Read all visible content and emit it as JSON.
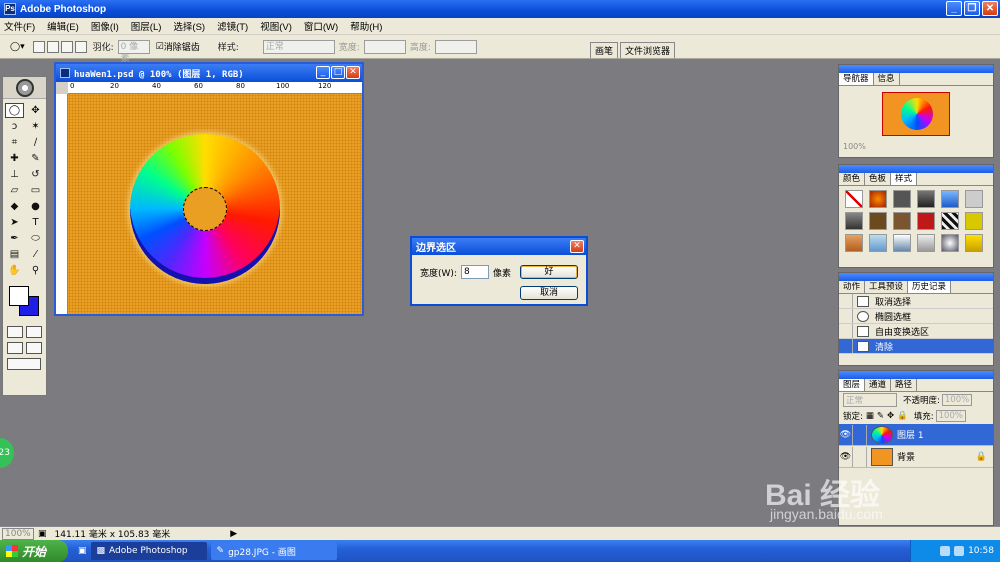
{
  "app": {
    "title": "Adobe Photoshop"
  },
  "menu": [
    "文件(F)",
    "编辑(E)",
    "图像(I)",
    "图层(L)",
    "选择(S)",
    "滤镜(T)",
    "视图(V)",
    "窗口(W)",
    "帮助(H)"
  ],
  "options": {
    "feather_label": "羽化:",
    "feather_value": "0 像素",
    "antialias_label": "消除锯齿",
    "style_label": "样式:",
    "style_value": "正常",
    "width_label": "宽度:",
    "height_label": "高度:"
  },
  "wells": [
    "画笔",
    "文件浏览器"
  ],
  "document": {
    "title": "huaWen1.psd @ 100% (图层 1, RGB)",
    "ruler": [
      "0",
      "20",
      "40",
      "60",
      "80",
      "100",
      "120"
    ]
  },
  "dialog": {
    "title": "边界选区",
    "width_label": "宽度(W):",
    "width_value": "8",
    "unit": "像素",
    "ok": "好",
    "cancel": "取消"
  },
  "navigator": {
    "tabs": [
      "导航器",
      "信息"
    ],
    "zoom": "100%"
  },
  "styles_panel": {
    "tabs": [
      "颜色",
      "色板",
      "样式"
    ]
  },
  "history": {
    "tabs": [
      "动作",
      "工具预设",
      "历史记录"
    ],
    "items": [
      "取消选择",
      "椭圆选框",
      "自由变换选区",
      "清除"
    ]
  },
  "layers": {
    "tabs": [
      "图层",
      "通道",
      "路径"
    ],
    "blend": "正常",
    "opacity_label": "不透明度:",
    "opacity_value": "100%",
    "lock_label": "锁定:",
    "fill_label": "填充:",
    "fill_value": "100%",
    "items": [
      {
        "name": "图层 1",
        "selected": true
      },
      {
        "name": "背景",
        "selected": false
      }
    ]
  },
  "status": {
    "zoom": "100%",
    "size": "141.11 毫米 x 105.83 毫米"
  },
  "taskbar": {
    "start": "开始",
    "tasks": [
      "Adobe Photoshop",
      "gp28.JPG - 画图"
    ],
    "time": "10:58"
  },
  "badge": "23",
  "watermark": {
    "main": "Bai 经验",
    "sub": "jingyan.baidu.com"
  },
  "colors": {
    "foreground": "#ffffff",
    "background": "#1e1ee6",
    "accent": "#0a4ed8",
    "canvas": "#ea9e22"
  }
}
